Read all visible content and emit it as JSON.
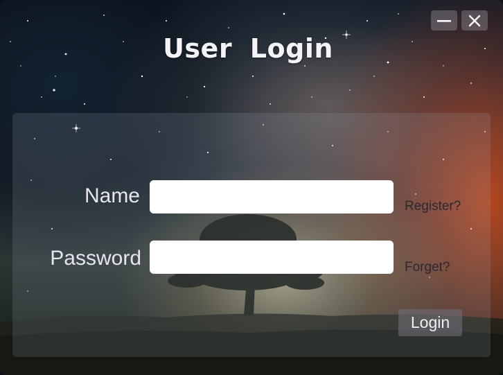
{
  "window": {
    "title": "User  Login",
    "controls": {
      "minimize_icon": "minimize-icon",
      "close_icon": "close-icon"
    }
  },
  "form": {
    "name_label": "Name",
    "name_value": "",
    "password_label": "Password",
    "password_value": "",
    "register_link": "Register?",
    "forget_link": "Forget?",
    "login_button": "Login"
  },
  "colors": {
    "title": "#f4f4f6",
    "label": "#e8e4f1",
    "link": "#2a2830",
    "button_bg": "#6e6e76"
  }
}
